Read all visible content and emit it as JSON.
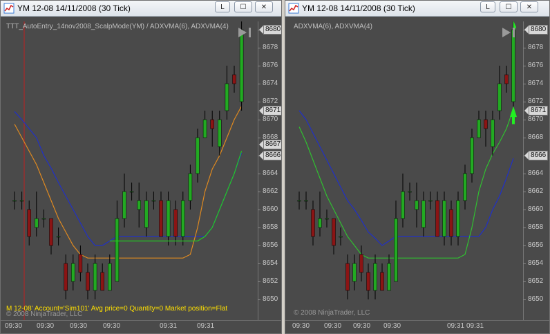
{
  "left_window": {
    "title": "YM 12-08  14/11/2008 (30 Tick)",
    "buttons": [
      "L",
      "☐",
      "✕"
    ],
    "indicator_label": "TTT_AutoEntry_14nov2008_ScalpMode(YM) / ADXVMA(6), ADXVMA(4)",
    "copyright": "© 2008 NinjaTrader, LLC",
    "status_line": "M 12-08' Account='Sim101' Avg price=0 Quantity=0 Market position=Flat",
    "price_ticks": [
      "8680",
      "8678",
      "8676",
      "8674",
      "8672",
      "8670",
      "8668",
      "8666",
      "8664",
      "8662",
      "8660",
      "8658",
      "8656",
      "8654",
      "8652",
      "8650"
    ],
    "price_tags": [
      "8680",
      "8671",
      "8667",
      "8666"
    ],
    "time_labels": [
      "09:30",
      "09:30",
      "09:30",
      "09:30",
      "09:31",
      "09:31"
    ]
  },
  "right_window": {
    "title": "YM 12-08  14/11/2008 (30 Tick)",
    "buttons": [
      "L",
      "☐",
      "✕"
    ],
    "indicator_label": "ADXVMA(6), ADXVMA(4)",
    "copyright": "© 2008 NinjaTrader, LLC",
    "price_ticks": [
      "8680",
      "8678",
      "8676",
      "8674",
      "8672",
      "8670",
      "8668",
      "8666",
      "8664",
      "8662",
      "8660",
      "8658",
      "8656",
      "8654",
      "8652",
      "8650"
    ],
    "price_tags": [
      "8680",
      "8671",
      "8666"
    ],
    "time_labels": [
      "09:30",
      "09:30",
      "09:30",
      "09:30",
      "09:31",
      "09:31"
    ]
  },
  "colors": {
    "background": "#4a4a4a",
    "up_bar": "#22aa22",
    "down_bar": "#8b1414",
    "adxvma6_left": "#2030c8",
    "adxvma4_left": "#e08a20",
    "signal_line_left": "#22cc22",
    "adxvma6_right": "#2030c8",
    "adxvma4_right": "#30c030",
    "session_line": "#c02020",
    "status_text": "#ffe000"
  },
  "icons": [
    "chart-icon",
    "scroll-to-end-icon",
    "up-arrow-signal-icon"
  ]
}
